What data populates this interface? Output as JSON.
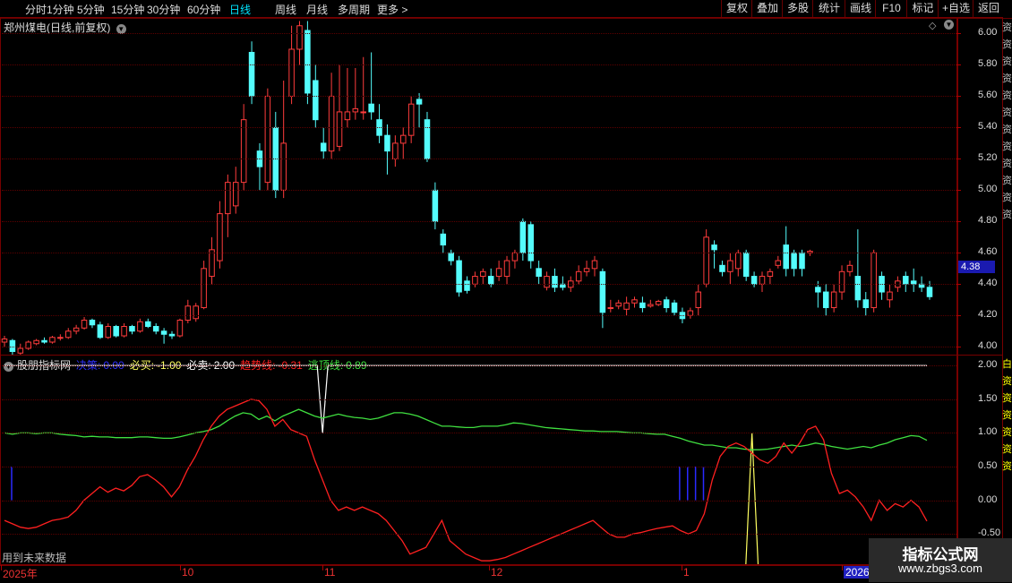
{
  "periods": [
    {
      "label": "分时",
      "active": false
    },
    {
      "label": "1分钟",
      "active": false
    },
    {
      "label": "5分钟",
      "active": false
    },
    {
      "label": "15分钟",
      "active": false
    },
    {
      "label": "30分钟",
      "active": false
    },
    {
      "label": "60分钟",
      "active": false
    },
    {
      "label": "日线",
      "active": true
    },
    {
      "label": "周线",
      "active": false
    },
    {
      "label": "月线",
      "active": false
    },
    {
      "label": "多周期",
      "active": false
    },
    {
      "label": "更多 >",
      "active": false
    }
  ],
  "toolbar": [
    "复权",
    "叠加",
    "多股",
    "统计",
    "画线",
    "F10",
    "标记",
    "+自选",
    "返回"
  ],
  "stock_title": "郑州煤电(日线,前复权)",
  "price_axis": [
    "6.00",
    "5.80",
    "5.60",
    "5.40",
    "5.20",
    "5.00",
    "4.80",
    "4.60",
    "4.40",
    "4.20",
    "4.00"
  ],
  "current_price": "4.38",
  "indicator": {
    "name": "股朋指标网",
    "jue_ce_label": "决策:",
    "jue_ce_value": "0.00",
    "bi_mai_label": "必买:",
    "bi_mai_value": "-1.00",
    "bi_mai2_label": "必卖:",
    "bi_mai2_value": "2.00",
    "trend_label": "趋势线:",
    "trend_value": "-0.31",
    "escape_label": "逃顶线:",
    "escape_value": "0.89"
  },
  "ind_axis": [
    "2.00",
    "1.50",
    "1.00",
    "0.50",
    "0.00",
    "-0.50"
  ],
  "future_note": "用到未来数据",
  "dates": [
    {
      "label": "2025年",
      "highlight": false
    },
    {
      "label": "10",
      "highlight": false
    },
    {
      "label": "11",
      "highlight": false
    },
    {
      "label": "12",
      "highlight": false
    },
    {
      "label": "1",
      "highlight": false
    },
    {
      "label": "2026",
      "highlight": true
    }
  ],
  "watermark": {
    "title": "指标公式网",
    "url": "www.zbgs3.com"
  },
  "right_strip_text": "资资资资资资资资资资资资",
  "right_strip_ind": "白资资资资资资",
  "colors": {
    "up": "#ff3c3c",
    "down": "#54fcfc",
    "trend": "#ff2020",
    "escape": "#40e040",
    "buy_line": "#ffff60",
    "top_line": "#ffffff",
    "decision": "#2a2aff"
  },
  "chart_data": {
    "type": "candlestick",
    "candles": [
      [
        4.03,
        4.05,
        4.07,
        4.0
      ],
      [
        4.04,
        3.97,
        4.05,
        3.95
      ],
      [
        3.96,
        3.99,
        4.02,
        3.95
      ],
      [
        3.99,
        4.03,
        4.04,
        3.98
      ],
      [
        4.02,
        4.04,
        4.05,
        4.01
      ],
      [
        4.04,
        4.03,
        4.06,
        4.02
      ],
      [
        4.03,
        4.06,
        4.07,
        4.02
      ],
      [
        4.06,
        4.06,
        4.08,
        4.04
      ],
      [
        4.06,
        4.1,
        4.12,
        4.05
      ],
      [
        4.1,
        4.12,
        4.14,
        4.08
      ],
      [
        4.12,
        4.17,
        4.19,
        4.11
      ],
      [
        4.17,
        4.14,
        4.18,
        4.12
      ],
      [
        4.14,
        4.06,
        4.16,
        4.05
      ],
      [
        4.06,
        4.13,
        4.15,
        4.05
      ],
      [
        4.13,
        4.07,
        4.14,
        4.06
      ],
      [
        4.07,
        4.13,
        4.15,
        4.06
      ],
      [
        4.13,
        4.1,
        4.14,
        4.08
      ],
      [
        4.1,
        4.16,
        4.18,
        4.09
      ],
      [
        4.16,
        4.13,
        4.18,
        4.12
      ],
      [
        4.13,
        4.1,
        4.15,
        4.08
      ],
      [
        4.1,
        4.08,
        4.12,
        4.02
      ],
      [
        4.08,
        4.07,
        4.1,
        4.05
      ],
      [
        4.07,
        4.17,
        4.18,
        4.06
      ],
      [
        4.17,
        4.26,
        4.3,
        4.15
      ],
      [
        4.18,
        4.26,
        4.28,
        4.16
      ],
      [
        4.25,
        4.5,
        4.55,
        4.24
      ],
      [
        4.45,
        4.62,
        4.7,
        4.4
      ],
      [
        4.55,
        4.85,
        4.93,
        4.5
      ],
      [
        4.85,
        5.05,
        5.1,
        4.7
      ],
      [
        4.9,
        5.05,
        5.15,
        4.85
      ],
      [
        5.05,
        5.45,
        5.55,
        5.0
      ],
      [
        5.88,
        5.6,
        5.95,
        5.55
      ],
      [
        5.25,
        5.15,
        5.3,
        5.0
      ],
      [
        5.05,
        5.6,
        5.65,
        5.0
      ],
      [
        5.4,
        5.0,
        5.5,
        4.95
      ],
      [
        5.0,
        5.3,
        5.7,
        4.95
      ],
      [
        5.6,
        5.9,
        6.05,
        5.55
      ],
      [
        5.9,
        6.05,
        6.08,
        5.8
      ],
      [
        6.02,
        5.62,
        6.08,
        5.55
      ],
      [
        5.7,
        5.45,
        5.8,
        5.4
      ],
      [
        5.3,
        5.25,
        5.4,
        5.2
      ],
      [
        5.25,
        5.6,
        5.75,
        5.2
      ],
      [
        5.28,
        5.5,
        5.8,
        5.25
      ],
      [
        5.45,
        5.5,
        5.78,
        5.4
      ],
      [
        5.5,
        5.52,
        5.78,
        5.45
      ],
      [
        5.5,
        5.5,
        5.85,
        5.45
      ],
      [
        5.55,
        5.5,
        5.88,
        5.45
      ],
      [
        5.45,
        5.35,
        5.55,
        5.3
      ],
      [
        5.35,
        5.25,
        5.42,
        5.1
      ],
      [
        5.2,
        5.3,
        5.35,
        5.15
      ],
      [
        5.3,
        5.35,
        5.4,
        5.2
      ],
      [
        5.35,
        5.55,
        5.6,
        5.3
      ],
      [
        5.58,
        5.55,
        5.62,
        5.4
      ],
      [
        5.45,
        5.2,
        5.5,
        5.18
      ],
      [
        5.0,
        4.8,
        5.05,
        4.75
      ],
      [
        4.72,
        4.65,
        4.75,
        4.6
      ],
      [
        4.6,
        4.55,
        4.62,
        4.52
      ],
      [
        4.55,
        4.35,
        4.58,
        4.32
      ],
      [
        4.42,
        4.36,
        4.45,
        4.34
      ],
      [
        4.4,
        4.45,
        4.48,
        4.38
      ],
      [
        4.45,
        4.48,
        4.5,
        4.4
      ],
      [
        4.45,
        4.4,
        4.5,
        4.38
      ],
      [
        4.45,
        4.5,
        4.55,
        4.42
      ],
      [
        4.45,
        4.55,
        4.58,
        4.4
      ],
      [
        4.55,
        4.6,
        4.62,
        4.5
      ],
      [
        4.8,
        4.6,
        4.82,
        4.55
      ],
      [
        4.78,
        4.55,
        4.8,
        4.5
      ],
      [
        4.5,
        4.45,
        4.55,
        4.4
      ],
      [
        4.38,
        4.45,
        4.48,
        4.36
      ],
      [
        4.45,
        4.38,
        4.5,
        4.35
      ],
      [
        4.4,
        4.38,
        4.45,
        4.36
      ],
      [
        4.38,
        4.42,
        4.45,
        4.35
      ],
      [
        4.42,
        4.48,
        4.52,
        4.4
      ],
      [
        4.48,
        4.5,
        4.55,
        4.45
      ],
      [
        4.5,
        4.55,
        4.58,
        4.45
      ],
      [
        4.48,
        4.22,
        4.5,
        4.12
      ],
      [
        4.25,
        4.25,
        4.3,
        4.22
      ],
      [
        4.26,
        4.28,
        4.3,
        4.24
      ],
      [
        4.24,
        4.28,
        4.32,
        4.2
      ],
      [
        4.28,
        4.3,
        4.32,
        4.25
      ],
      [
        4.28,
        4.25,
        4.32,
        4.22
      ],
      [
        4.26,
        4.27,
        4.3,
        4.25
      ],
      [
        4.27,
        4.29,
        4.3,
        4.26
      ],
      [
        4.3,
        4.25,
        4.32,
        4.22
      ],
      [
        4.28,
        4.22,
        4.3,
        4.2
      ],
      [
        4.22,
        4.18,
        4.25,
        4.15
      ],
      [
        4.2,
        4.23,
        4.25,
        4.18
      ],
      [
        4.25,
        4.35,
        4.4,
        4.2
      ],
      [
        4.4,
        4.7,
        4.75,
        4.38
      ],
      [
        4.65,
        4.62,
        4.68,
        4.5
      ],
      [
        4.52,
        4.48,
        4.55,
        4.45
      ],
      [
        4.48,
        4.55,
        4.6,
        4.4
      ],
      [
        4.5,
        4.6,
        4.62,
        4.45
      ],
      [
        4.6,
        4.45,
        4.62,
        4.42
      ],
      [
        4.45,
        4.4,
        4.48,
        4.38
      ],
      [
        4.4,
        4.45,
        4.48,
        4.35
      ],
      [
        4.45,
        4.48,
        4.5,
        4.4
      ],
      [
        4.52,
        4.55,
        4.58,
        4.5
      ],
      [
        4.65,
        4.5,
        4.77,
        4.45
      ],
      [
        4.6,
        4.5,
        4.62,
        4.45
      ],
      [
        4.6,
        4.5,
        4.62,
        4.45
      ],
      [
        4.6,
        4.61,
        4.62,
        4.58
      ],
      [
        4.38,
        4.35,
        4.42,
        4.25
      ],
      [
        4.35,
        4.25,
        4.4,
        4.2
      ],
      [
        4.25,
        4.35,
        4.4,
        4.22
      ],
      [
        4.35,
        4.48,
        4.52,
        4.3
      ],
      [
        4.48,
        4.52,
        4.55,
        4.45
      ],
      [
        4.45,
        4.3,
        4.75,
        4.25
      ],
      [
        4.3,
        4.25,
        4.35,
        4.2
      ],
      [
        4.25,
        4.6,
        4.62,
        4.22
      ],
      [
        4.45,
        4.35,
        4.48,
        4.3
      ],
      [
        4.3,
        4.35,
        4.4,
        4.25
      ],
      [
        4.38,
        4.42,
        4.45,
        4.35
      ],
      [
        4.45,
        4.4,
        4.48,
        4.35
      ],
      [
        4.42,
        4.4,
        4.5,
        4.35
      ],
      [
        4.4,
        4.38,
        4.45,
        4.35
      ],
      [
        4.38,
        4.32,
        4.42,
        4.3
      ]
    ],
    "price_range": [
      3.95,
      6.1
    ],
    "ind_range": [
      -0.95,
      2.15
    ],
    "trend": [
      -0.3,
      -0.35,
      -0.4,
      -0.42,
      -0.4,
      -0.35,
      -0.3,
      -0.28,
      -0.25,
      -0.15,
      0.0,
      0.1,
      0.2,
      0.12,
      0.18,
      0.14,
      0.22,
      0.35,
      0.38,
      0.3,
      0.2,
      0.05,
      0.2,
      0.45,
      0.65,
      0.9,
      1.1,
      1.25,
      1.35,
      1.4,
      1.45,
      1.5,
      1.48,
      1.35,
      1.1,
      1.2,
      1.05,
      1.0,
      0.95,
      0.6,
      0.3,
      0.0,
      -0.15,
      -0.1,
      -0.15,
      -0.1,
      -0.15,
      -0.2,
      -0.3,
      -0.45,
      -0.6,
      -0.8,
      -0.75,
      -0.7,
      -0.5,
      -0.3,
      -0.6,
      -0.7,
      -0.8,
      -0.85,
      -0.9,
      -0.9,
      -0.88,
      -0.85,
      -0.8,
      -0.75,
      -0.7,
      -0.65,
      -0.6,
      -0.55,
      -0.5,
      -0.45,
      -0.4,
      -0.35,
      -0.3,
      -0.4,
      -0.5,
      -0.55,
      -0.55,
      -0.5,
      -0.48,
      -0.45,
      -0.42,
      -0.4,
      -0.38,
      -0.45,
      -0.5,
      -0.45,
      -0.2,
      0.3,
      0.65,
      0.8,
      0.85,
      0.8,
      0.7,
      0.6,
      0.55,
      0.65,
      0.85,
      0.7,
      0.85,
      1.05,
      1.1,
      0.9,
      0.4,
      0.1,
      0.15,
      0.05,
      -0.1,
      -0.3,
      0.0,
      -0.15,
      -0.05,
      -0.1,
      0.0,
      -0.1,
      -0.31
    ],
    "escape": [
      1.0,
      0.98,
      1.0,
      1.0,
      0.99,
      1.0,
      1.0,
      0.98,
      0.97,
      0.96,
      0.94,
      0.95,
      0.94,
      0.94,
      0.93,
      0.93,
      0.93,
      0.94,
      0.94,
      0.93,
      0.92,
      0.92,
      0.94,
      0.97,
      1.0,
      1.02,
      1.05,
      1.1,
      1.18,
      1.25,
      1.3,
      1.28,
      1.2,
      1.25,
      1.18,
      1.25,
      1.3,
      1.35,
      1.3,
      1.25,
      1.22,
      1.25,
      1.28,
      1.25,
      1.23,
      1.22,
      1.2,
      1.22,
      1.26,
      1.3,
      1.3,
      1.28,
      1.25,
      1.2,
      1.15,
      1.1,
      1.1,
      1.09,
      1.08,
      1.08,
      1.1,
      1.1,
      1.1,
      1.12,
      1.15,
      1.14,
      1.12,
      1.1,
      1.08,
      1.07,
      1.06,
      1.05,
      1.04,
      1.03,
      1.03,
      1.02,
      1.02,
      1.02,
      1.01,
      1.0,
      1.0,
      0.99,
      0.98,
      0.98,
      0.95,
      0.92,
      0.88,
      0.85,
      0.82,
      0.82,
      0.8,
      0.78,
      0.78,
      0.76,
      0.75,
      0.75,
      0.76,
      0.78,
      0.8,
      0.82,
      0.8,
      0.82,
      0.85,
      0.83,
      0.8,
      0.78,
      0.76,
      0.78,
      0.8,
      0.78,
      0.82,
      0.85,
      0.9,
      0.93,
      0.96,
      0.95,
      0.89
    ],
    "decision_bars": [
      0,
      84,
      85,
      86,
      87
    ],
    "top_spike_index": 40,
    "buy_spike_index": 94
  }
}
